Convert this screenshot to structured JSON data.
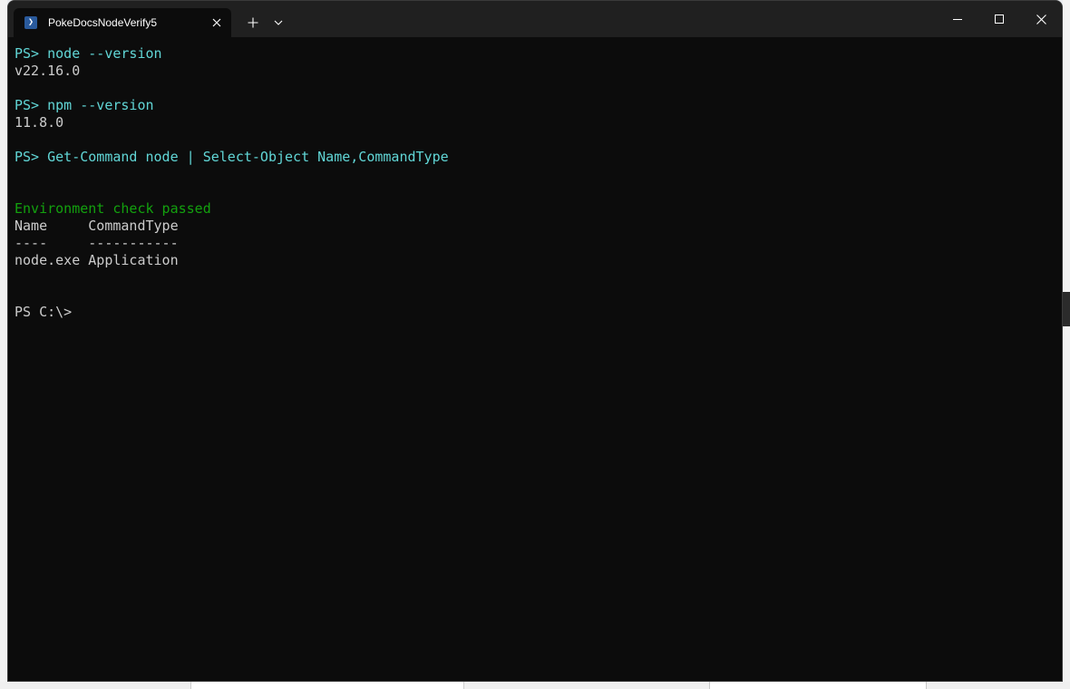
{
  "window": {
    "tab_title": "PokeDocsNodeVerify5",
    "tab_icon": "powershell-icon"
  },
  "colors": {
    "background": "#0c0c0c",
    "titlebar": "#202020",
    "command_text": "#61d6d6",
    "success_text": "#13a10e",
    "output_text": "#cccccc"
  },
  "console": {
    "lines": [
      {
        "text": "PS> node --version",
        "kind": "command"
      },
      {
        "text": "v22.16.0",
        "kind": "output"
      },
      {
        "text": "",
        "kind": "blank"
      },
      {
        "text": "PS> npm --version",
        "kind": "command"
      },
      {
        "text": "11.8.0",
        "kind": "output"
      },
      {
        "text": "",
        "kind": "blank"
      },
      {
        "text": "PS> Get-Command node | Select-Object Name,CommandType",
        "kind": "command"
      },
      {
        "text": "",
        "kind": "blank"
      },
      {
        "text": "",
        "kind": "blank"
      },
      {
        "text": "Environment check passed",
        "kind": "success"
      },
      {
        "text": "Name     CommandType",
        "kind": "output"
      },
      {
        "text": "----     -----------",
        "kind": "output"
      },
      {
        "text": "node.exe Application",
        "kind": "output"
      },
      {
        "text": "",
        "kind": "blank"
      },
      {
        "text": "",
        "kind": "blank"
      },
      {
        "text": "PS C:\\>",
        "kind": "prompt"
      }
    ]
  }
}
